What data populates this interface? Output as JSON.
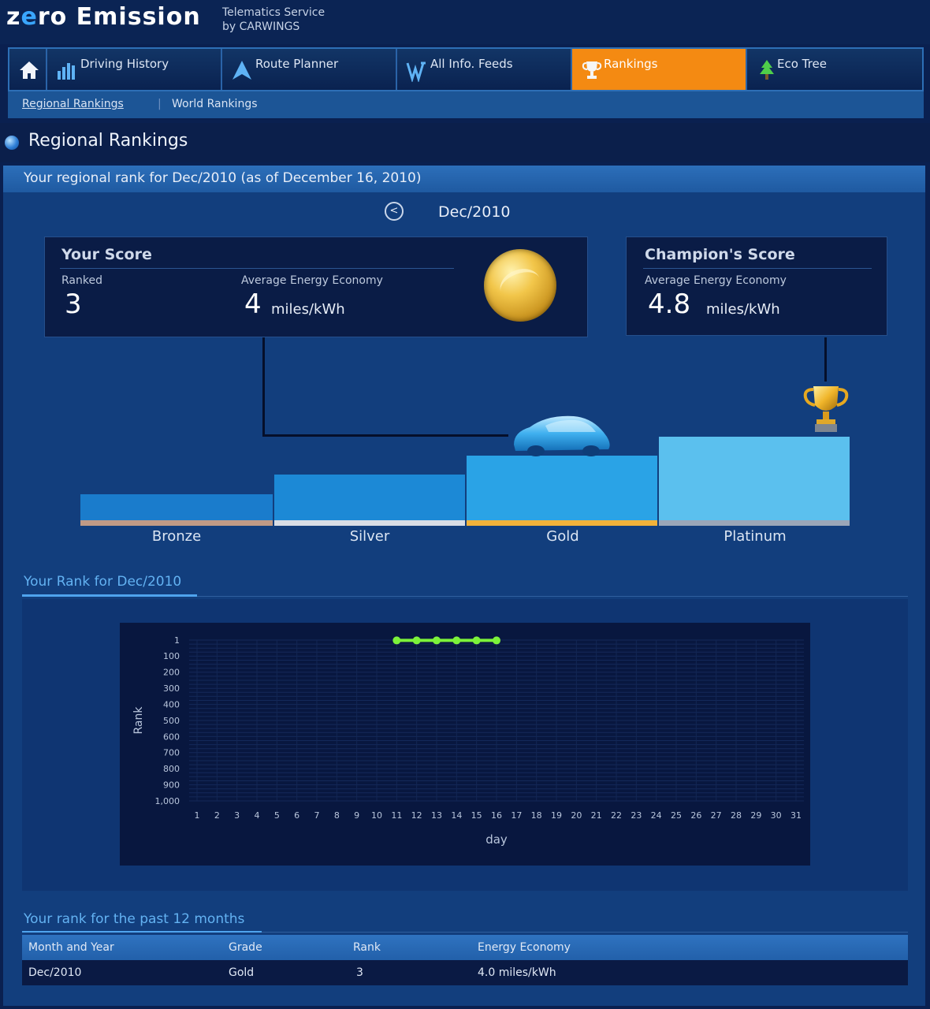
{
  "header": {
    "logo": {
      "prefix": "z",
      "o_glyph": "e",
      "suffix": "ro Emission"
    },
    "tagline_line1": "Telematics Service",
    "tagline_line2": "by CARWINGS"
  },
  "nav": {
    "items": [
      {
        "label": "",
        "icon": "home-icon"
      },
      {
        "label": "Driving History",
        "icon": "bar-chart-icon"
      },
      {
        "label": "Route Planner",
        "icon": "arrow-up-icon"
      },
      {
        "label": "All Info. Feeds",
        "icon": "feed-icon"
      },
      {
        "label": "Rankings",
        "icon": "trophy-icon",
        "active": true
      },
      {
        "label": "Eco Tree",
        "icon": "tree-icon"
      }
    ],
    "subnav": {
      "regional": "Regional Rankings",
      "world": "World Rankings",
      "separator": "|"
    }
  },
  "page": {
    "title": "Regional Rankings",
    "panel_heading": "Your regional rank for Dec/2010 (as of December 16, 2010)",
    "month": "Dec/2010",
    "prev_glyph": "<"
  },
  "your_score": {
    "title": "Your Score",
    "ranked_label": "Ranked",
    "ranked_value": "3",
    "economy_label": "Average Energy Economy",
    "economy_value": "4",
    "economy_unit": "miles/kWh"
  },
  "champion_score": {
    "title": "Champion's Score",
    "economy_label": "Average Energy Economy",
    "economy_value": "4.8",
    "economy_unit": "miles/kWh"
  },
  "podium": {
    "tiers": [
      {
        "label": "Bronze",
        "base_color": "#c09a86",
        "bar_color": "#1a7ccc"
      },
      {
        "label": "Silver",
        "base_color": "#d8dde6",
        "bar_color": "#1c89d6"
      },
      {
        "label": "Gold",
        "base_color": "#f2b23a",
        "bar_color": "#2aa3e6"
      },
      {
        "label": "Platinum",
        "base_color": "#9aa6b8",
        "bar_color": "#5bc0ee"
      }
    ],
    "current_tier": "Gold"
  },
  "rank_chart": {
    "heading": "Your Rank for Dec/2010"
  },
  "chart_data": {
    "type": "line",
    "x": [
      11,
      12,
      13,
      14,
      15,
      16
    ],
    "y": [
      3,
      3,
      3,
      3,
      3,
      3
    ],
    "ylabel": "Rank",
    "xlabel": "day",
    "y_ticks": [
      "1",
      "100",
      "200",
      "300",
      "400",
      "500",
      "600",
      "700",
      "800",
      "900",
      "1,000"
    ],
    "x_ticks": [
      "1",
      "2",
      "3",
      "4",
      "5",
      "6",
      "7",
      "8",
      "9",
      "10",
      "11",
      "12",
      "13",
      "14",
      "15",
      "16",
      "17",
      "18",
      "19",
      "20",
      "21",
      "22",
      "23",
      "24",
      "25",
      "26",
      "27",
      "28",
      "29",
      "30",
      "31"
    ],
    "ylim": [
      1,
      1000
    ],
    "y_inverted": true,
    "xlim": [
      1,
      31
    ],
    "grid": true,
    "series_color": "#7cf23a"
  },
  "history": {
    "heading": "Your rank for the past 12 months",
    "columns": [
      "Month and Year",
      "Grade",
      "Rank",
      "Energy Economy"
    ],
    "rows": [
      [
        "Dec/2010",
        "Gold",
        "3",
        "4.0 miles/kWh"
      ]
    ]
  },
  "colors": {
    "accent_active": "#f48a12",
    "background": "#0a2050",
    "link": "#63b2f2"
  }
}
